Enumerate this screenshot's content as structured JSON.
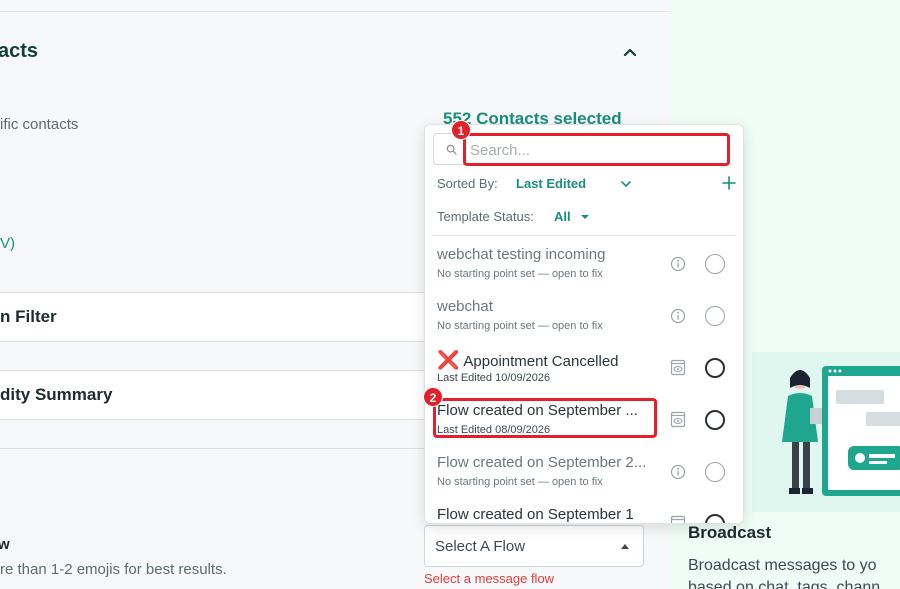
{
  "section": {
    "title": "acts",
    "subtext": "ific contacts",
    "link_fragment": "V)",
    "selected_count": "552 Contacts selected"
  },
  "cards": [
    {
      "label": "n Filter"
    },
    {
      "label": "dity Summary"
    }
  ],
  "flow_field": {
    "label": "w",
    "hint": "re than 1-2 emojis for best results.",
    "select_placeholder": "Select A Flow",
    "error": "Select a message flow"
  },
  "dropdown": {
    "search_placeholder": "Search...",
    "sorted_by_label": "Sorted By:",
    "sorted_by_value": "Last Edited",
    "template_status_label": "Template Status:",
    "template_status_value": "All",
    "items": [
      {
        "name": "webchat testing incoming",
        "meta": "No starting point set — open to fix",
        "icon": "info-icon",
        "active": false
      },
      {
        "name": "webchat",
        "meta": "No starting point set — open to fix",
        "icon": "info-icon",
        "active": false
      },
      {
        "name": "Appointment Cancelled",
        "meta": "Last Edited 10/09/2026",
        "icon": "preview-icon",
        "active": true,
        "prefix": "❌"
      },
      {
        "name": "Flow created on September ...",
        "meta": "Last Edited 08/09/2026",
        "icon": "preview-icon",
        "active": true
      },
      {
        "name": "Flow created on September 2...",
        "meta": "No starting point set — open to fix",
        "icon": "info-icon",
        "active": false
      },
      {
        "name": "Flow created on September 1",
        "meta": "",
        "icon": "preview-icon",
        "active": true
      }
    ]
  },
  "broadcast": {
    "title": "Broadcast",
    "desc_line1": "Broadcast messages to yo",
    "desc_line2": "based on chat, tags, chann"
  },
  "annotations": {
    "badge_1": "1",
    "badge_2": "2",
    "color": "#e4202a"
  },
  "colors": {
    "accent": "#1a8f7d",
    "error": "#e23d3d",
    "panel_bg": "#effdf7"
  }
}
